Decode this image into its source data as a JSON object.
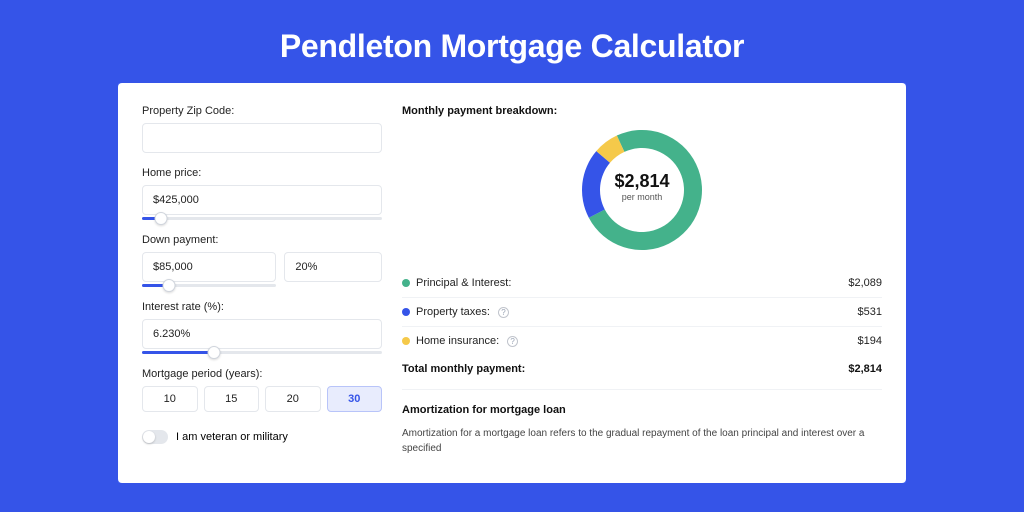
{
  "page_title": "Pendleton Mortgage Calculator",
  "form": {
    "zip_label": "Property Zip Code:",
    "zip_value": "",
    "price_label": "Home price:",
    "price_value": "$425,000",
    "price_slider_pct": 8,
    "down_label": "Down payment:",
    "down_value": "$85,000",
    "down_pct_value": "20%",
    "down_slider_pct": 20,
    "rate_label": "Interest rate (%):",
    "rate_value": "6.230%",
    "rate_slider_pct": 30,
    "period_label": "Mortgage period (years):",
    "periods": [
      "10",
      "15",
      "20",
      "30"
    ],
    "period_selected": 3,
    "veteran_label": "I am veteran or military"
  },
  "breakdown": {
    "title": "Monthly payment breakdown:",
    "center_amount": "$2,814",
    "center_sub": "per month",
    "items": [
      {
        "label": "Principal & Interest:",
        "value": "$2,089",
        "color": "#44b28b",
        "help": false,
        "num": 2089
      },
      {
        "label": "Property taxes:",
        "value": "$531",
        "color": "#3554e8",
        "help": true,
        "num": 531
      },
      {
        "label": "Home insurance:",
        "value": "$194",
        "color": "#f5c94a",
        "help": true,
        "num": 194
      }
    ],
    "total_label": "Total monthly payment:",
    "total_value": "$2,814"
  },
  "chart_data": {
    "type": "pie",
    "title": "Monthly payment breakdown",
    "categories": [
      "Principal & Interest",
      "Property taxes",
      "Home insurance"
    ],
    "values": [
      2089,
      531,
      194
    ],
    "colors": [
      "#44b28b",
      "#3554e8",
      "#f5c94a"
    ],
    "total": 2814,
    "unit": "USD/month"
  },
  "amort": {
    "title": "Amortization for mortgage loan",
    "text": "Amortization for a mortgage loan refers to the gradual repayment of the loan principal and interest over a specified"
  }
}
